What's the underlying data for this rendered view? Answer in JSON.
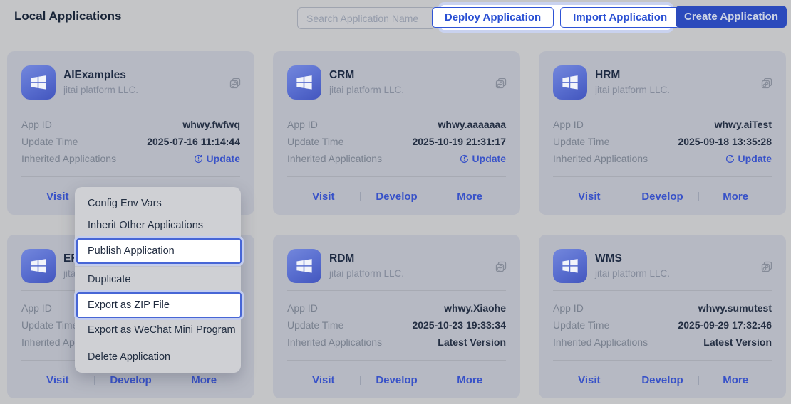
{
  "header": {
    "title": "Local Applications",
    "search_placeholder": "Search Application Name",
    "deploy_button": "Deploy Application",
    "import_button": "Import Application",
    "create_button": "Create Application"
  },
  "card_labels": {
    "app_id": "App ID",
    "update_time": "Update Time",
    "inherited_applications": "Inherited Applications",
    "update_link": "Update",
    "latest_version": "Latest Version",
    "visit": "Visit",
    "develop": "Develop",
    "more": "More"
  },
  "cards": [
    {
      "name": "AIExamples",
      "vendor": "jitai platform LLC.",
      "app_id": "whwy.fwfwq",
      "update_time": "2025-07-16 11:14:44",
      "inherited": "update"
    },
    {
      "name": "CRM",
      "vendor": "jitai platform LLC.",
      "app_id": "whwy.aaaaaaa",
      "update_time": "2025-10-19 21:31:17",
      "inherited": "update"
    },
    {
      "name": "HRM",
      "vendor": "jitai platform LLC.",
      "app_id": "whwy.aiTest",
      "update_time": "2025-09-18 13:35:28",
      "inherited": "update"
    },
    {
      "name": "ERP",
      "vendor": "jitai platform LLC.",
      "app_id": "",
      "update_time": "",
      "inherited": "hidden"
    },
    {
      "name": "RDM",
      "vendor": "jitai platform LLC.",
      "app_id": "whwy.Xiaohe",
      "update_time": "2025-10-23 19:33:34",
      "inherited": "latest"
    },
    {
      "name": "WMS",
      "vendor": "jitai platform LLC.",
      "app_id": "whwy.sumutest",
      "update_time": "2025-09-29 17:32:46",
      "inherited": "latest"
    }
  ],
  "context_menu": {
    "items": [
      {
        "label": "Config Env Vars",
        "highlighted": false,
        "divider_after": false
      },
      {
        "label": "Inherit Other Applications",
        "highlighted": false,
        "divider_after": false
      },
      {
        "label": "Publish Application",
        "highlighted": true,
        "divider_after": true
      },
      {
        "label": "Duplicate",
        "highlighted": false,
        "divider_after": false
      },
      {
        "label": "Export as ZIP File",
        "highlighted": true,
        "divider_after": false
      },
      {
        "label": "Export as WeChat Mini Program",
        "highlighted": false,
        "divider_after": true
      },
      {
        "label": "Delete Application",
        "highlighted": false,
        "divider_after": false
      }
    ]
  },
  "colors": {
    "accent_blue": "#2f54d6",
    "create_button_bg": "#2b4abc",
    "link_blue": "#3852c8",
    "highlight_ring": "#c9d2ef",
    "card_bg": "#b6b9c3",
    "page_bg": "#c4c5c7"
  }
}
